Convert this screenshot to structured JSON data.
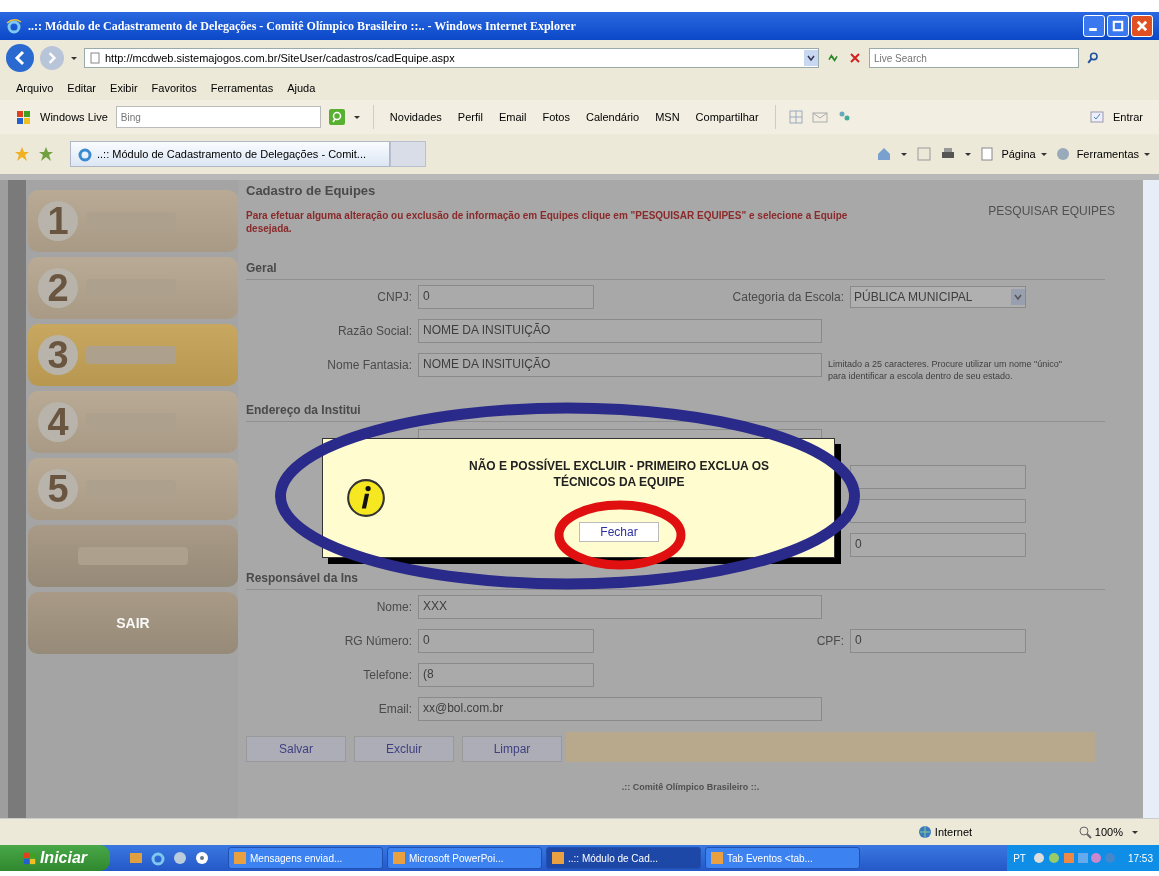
{
  "window": {
    "title": "..:: Módulo de Cadastramento de Delegações - Comitê Olímpico Brasileiro ::.. - Windows Internet Explorer"
  },
  "address_bar": {
    "url": "http://mcdweb.sistemajogos.com.br/SiteUser/cadastros/cadEquipe.aspx",
    "search_placeholder": "Live Search"
  },
  "menu": [
    "Arquivo",
    "Editar",
    "Exibir",
    "Favoritos",
    "Ferramentas",
    "Ajuda"
  ],
  "live_toolbar": {
    "brand": "Windows Live",
    "search_placeholder": "Bing",
    "links": [
      "Novidades",
      "Perfil",
      "Email",
      "Fotos",
      "Calendário",
      "MSN",
      "Compartilhar"
    ],
    "sign_in": "Entrar"
  },
  "tabs": [
    {
      "title": "..:: Módulo de Cadastramento de Delegações - Comit...",
      "selected": true
    }
  ],
  "command_bar": [
    "Página",
    "Ferramentas"
  ],
  "sidebar": {
    "steps": [
      {
        "number": "1",
        "selected": false
      },
      {
        "number": "2",
        "selected": false
      },
      {
        "number": "3",
        "selected": true
      },
      {
        "number": "4",
        "selected": false
      },
      {
        "number": "5",
        "selected": false
      }
    ],
    "exit_button": "SAIR"
  },
  "form": {
    "title": "Cadastro de Equipes",
    "notice": "Para efetuar alguma alteração ou exclusão de informação em Equipes clique em \"PESQUISAR EQUIPES\" e selecione a Equipe desejada.",
    "search_link": "PESQUISAR EQUIPES",
    "general": {
      "heading": "Geral",
      "cnpj": {
        "label": "CNPJ:",
        "value": "0"
      },
      "category": {
        "label": "Categoria da Escola:",
        "value": "PÚBLICA MUNICIPAL"
      },
      "corporate_name": {
        "label": "Razão Social:",
        "value": "NOME DA INSITUIÇÃO"
      },
      "trade_name": {
        "label": "Nome Fantasia:",
        "value": "NOME DA INSITUIÇÃO",
        "hint": "Limitado a 25 caracteres. Procure utilizar um nome \"único\" para identificar a escola dentro de seu estado."
      }
    },
    "address": {
      "heading": "Endereço da Institui",
      "number_value": "0"
    },
    "responsible": {
      "heading": "Responsável da Ins",
      "name": {
        "label": "Nome:",
        "value": "XXX"
      },
      "rg": {
        "label": "RG Número:",
        "value": "0"
      },
      "cpf": {
        "label": "CPF:",
        "value": "0"
      },
      "phone": {
        "label": "Telefone:",
        "value": "(8"
      },
      "email": {
        "label": "Email:",
        "value": "xx@bol.com.br"
      }
    },
    "actions": [
      "Salvar",
      "Excluir",
      "Limpar"
    ],
    "footer": ".:: Comitê Olímpico Brasileiro ::."
  },
  "dialog": {
    "message": "NÃO E POSSÍVEL EXCLUIR - PRIMEIRO EXCLUA OS TÉCNICOS DA EQUIPE",
    "button": "Fechar"
  },
  "status_bar": {
    "zone": "Internet",
    "zoom": "100%"
  },
  "taskbar": {
    "start": "Iniciar",
    "tasks": [
      {
        "label": "Mensagens enviad...",
        "selected": false
      },
      {
        "label": "Microsoft PowerPoi...",
        "selected": false
      },
      {
        "label": "..:: Módulo de Cad...",
        "selected": true
      },
      {
        "label": "Tab Eventos <tab...",
        "selected": false
      }
    ],
    "language": "PT",
    "clock": "17:53"
  }
}
